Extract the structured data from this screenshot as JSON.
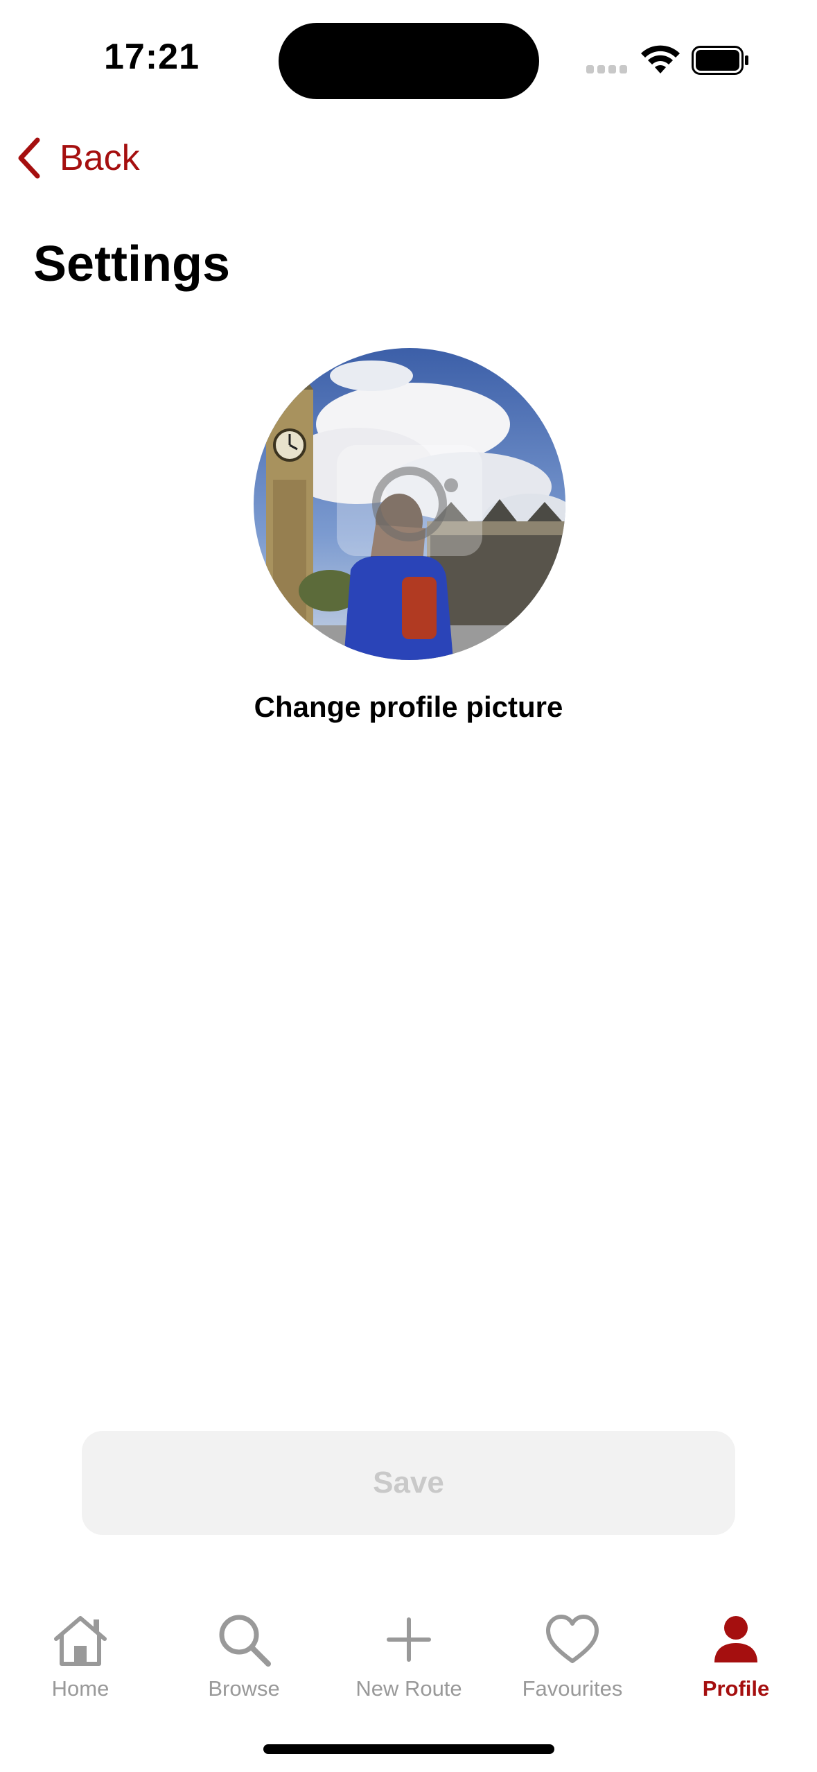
{
  "status_bar": {
    "time": "17:21"
  },
  "nav": {
    "back_label": "Back"
  },
  "page": {
    "title": "Settings"
  },
  "profile": {
    "change_picture_label": "Change profile picture"
  },
  "actions": {
    "save_label": "Save",
    "save_enabled": false
  },
  "tab_bar": {
    "items": [
      {
        "label": "Home",
        "icon": "home-icon",
        "active": false
      },
      {
        "label": "Browse",
        "icon": "search-icon",
        "active": false
      },
      {
        "label": "New Route",
        "icon": "plus-icon",
        "active": false
      },
      {
        "label": "Favourites",
        "icon": "heart-icon",
        "active": false
      },
      {
        "label": "Profile",
        "icon": "person-icon",
        "active": true
      }
    ]
  },
  "colors": {
    "accent": "#a50f0f",
    "inactive": "#999999",
    "disabled_button_bg": "#f2f2f2",
    "disabled_button_text": "#c9c9c9"
  }
}
